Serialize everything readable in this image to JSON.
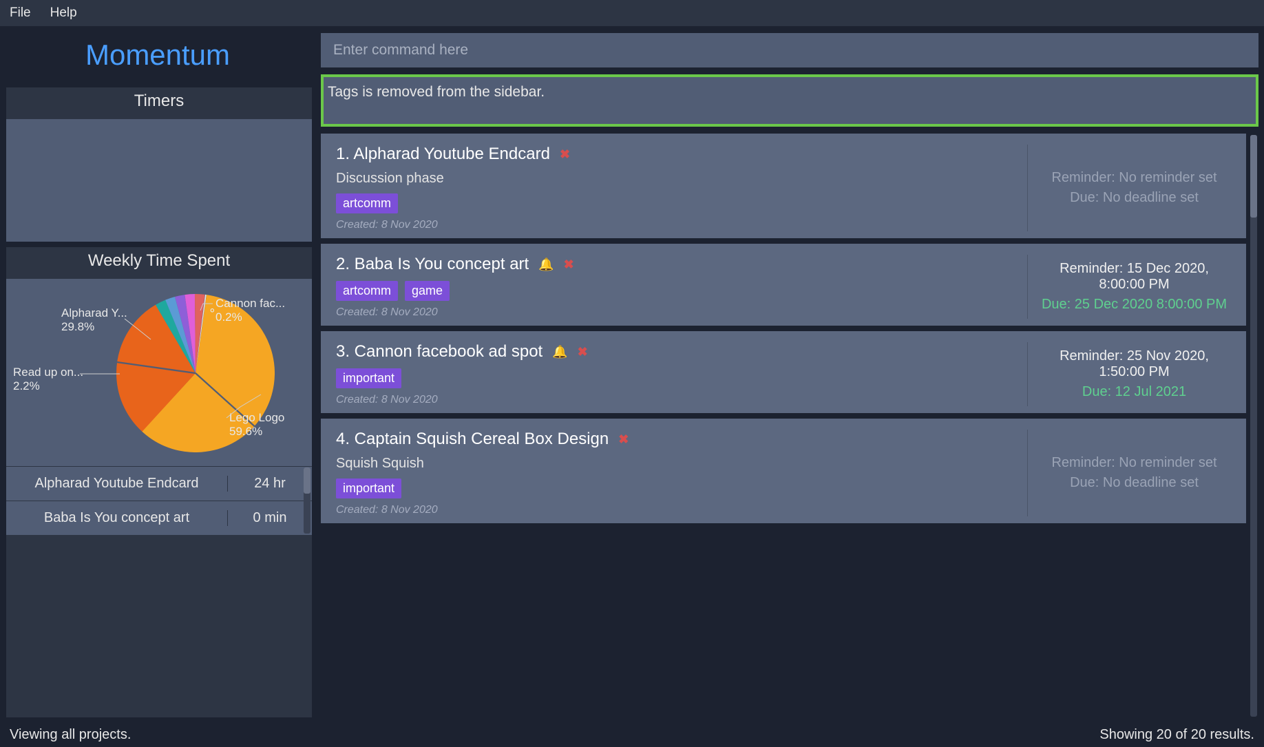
{
  "menu": {
    "file": "File",
    "help": "Help"
  },
  "app_title": "Momentum",
  "sidebar": {
    "timers_header": "Timers",
    "weekly_header": "Weekly Time Spent",
    "timer_rows": [
      {
        "name": "Alpharad Youtube Endcard",
        "value": "24 hr"
      },
      {
        "name": "Baba Is You concept art",
        "value": "0 min"
      }
    ]
  },
  "command": {
    "placeholder": "Enter command here"
  },
  "notice": "Tags is removed from the sidebar.",
  "projects": [
    {
      "title": "1. Alpharad Youtube Endcard",
      "has_bell": false,
      "has_x": true,
      "desc": "Discussion phase",
      "tags": [
        "artcomm"
      ],
      "created": "Created: 8 Nov 2020",
      "reminder": "Reminder: No reminder set",
      "reminder_set": false,
      "due": "Due: No deadline set",
      "due_set": false
    },
    {
      "title": "2. Baba Is You concept art",
      "has_bell": true,
      "has_x": true,
      "desc": "",
      "tags": [
        "artcomm",
        "game"
      ],
      "created": "Created: 8 Nov 2020",
      "reminder": "Reminder: 15 Dec 2020, 8:00:00 PM",
      "reminder_set": true,
      "due": "Due: 25 Dec 2020 8:00:00 PM",
      "due_set": true
    },
    {
      "title": "3. Cannon facebook ad spot",
      "has_bell": true,
      "has_x": true,
      "desc": "",
      "tags": [
        "important"
      ],
      "created": "Created: 8 Nov 2020",
      "reminder": "Reminder: 25 Nov 2020, 1:50:00 PM",
      "reminder_set": true,
      "due": "Due: 12 Jul 2021",
      "due_set": true
    },
    {
      "title": "4. Captain Squish Cereal Box Design",
      "has_bell": false,
      "has_x": true,
      "desc": "Squish Squish",
      "tags": [
        "important"
      ],
      "created": "Created: 8 Nov 2020",
      "reminder": "Reminder: No reminder set",
      "reminder_set": false,
      "due": "Due: No deadline set",
      "due_set": false
    }
  ],
  "status": {
    "left": "Viewing all projects.",
    "right": "Showing 20 of 20 results."
  },
  "chart_data": {
    "type": "pie",
    "title": "Weekly Time Spent",
    "slices": [
      {
        "label": "Lego Logo",
        "value": 59.6,
        "color": "#f5a623"
      },
      {
        "label": "Alpharad Y...",
        "value": 29.8,
        "color": "#e8641b"
      },
      {
        "label": "Read up on...",
        "value": 2.2,
        "color": "#1fa89e"
      },
      {
        "label": "Cannon fac...",
        "value": 0.2,
        "color": "#e6e6e6"
      },
      {
        "label_hidden": true,
        "value": 8.2,
        "color_gradient": [
          "#5b9bd5",
          "#8e5fd8",
          "#e05fd8",
          "#e0625f"
        ]
      }
    ],
    "labels_rendered": [
      {
        "text1": "Alpharad Y...",
        "text2": "29.8%"
      },
      {
        "text1": "Read up on...",
        "text2": "2.2%"
      },
      {
        "text1": "Cannon fac...",
        "text2": "0.2%"
      },
      {
        "text1": "Lego Logo",
        "text2": "59.6%"
      }
    ]
  }
}
